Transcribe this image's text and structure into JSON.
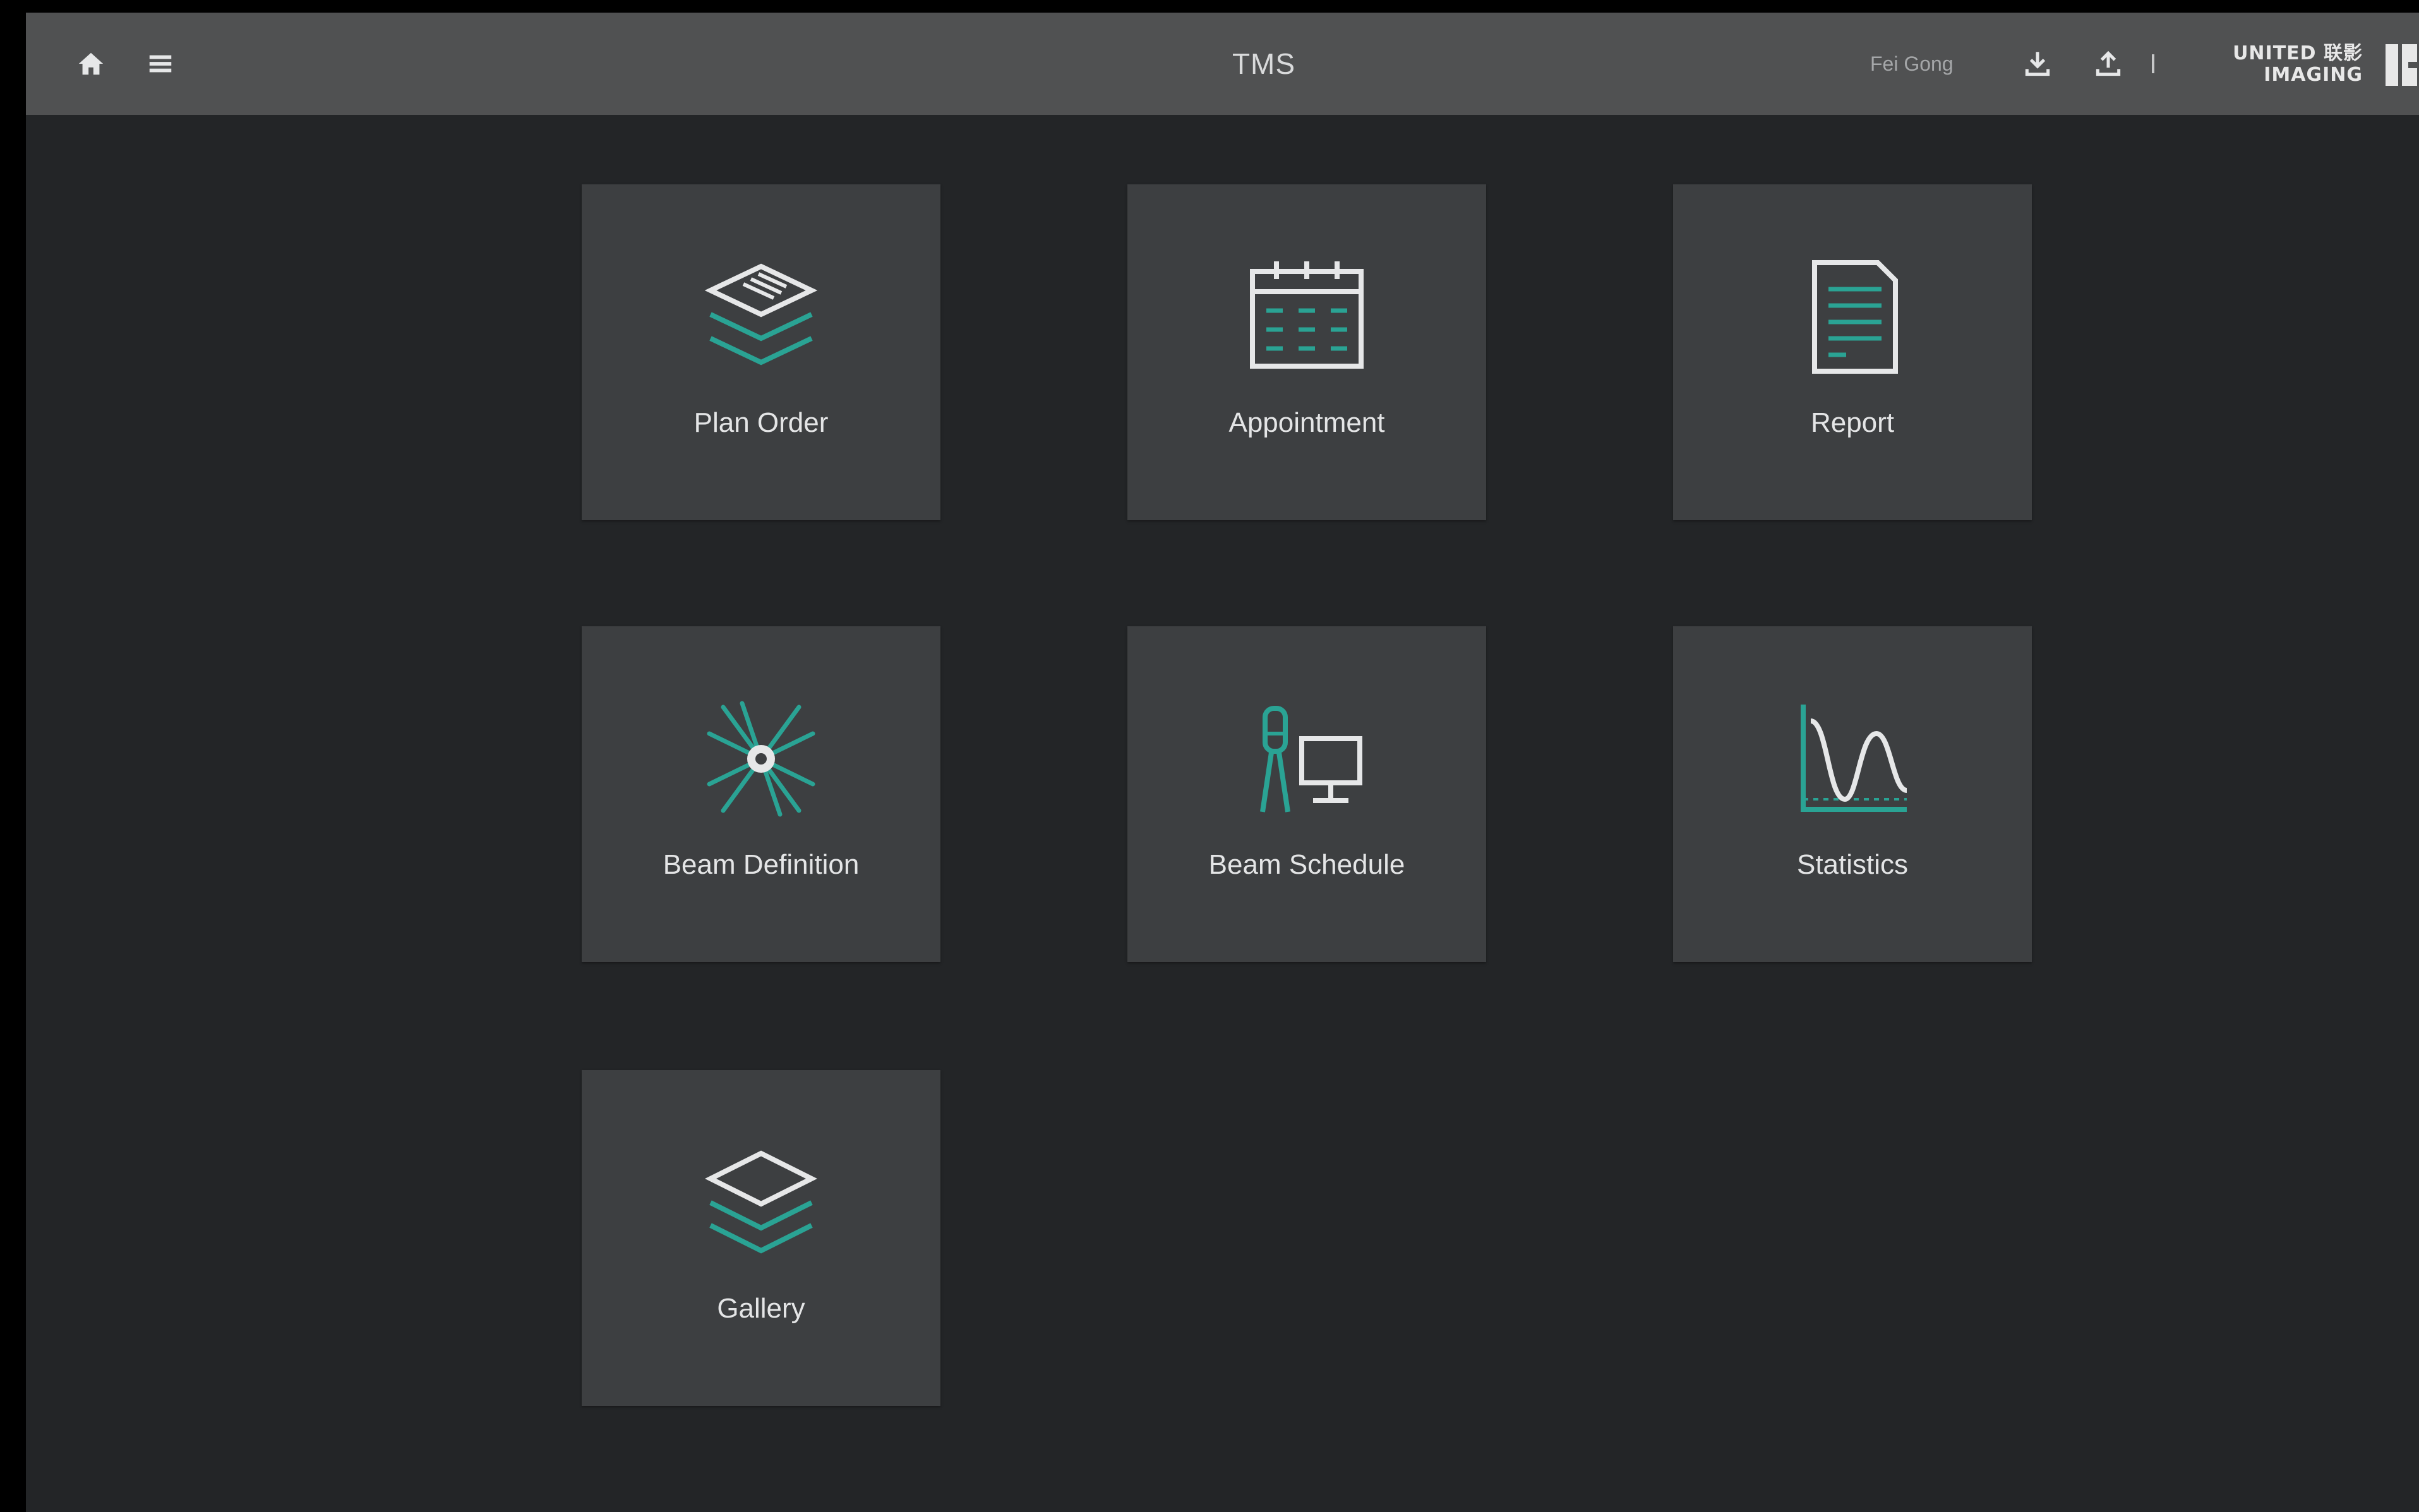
{
  "header": {
    "title": "TMS",
    "user_name": "Fei Gong",
    "brand_name": "UNITED 联影 IMAGING"
  },
  "tiles": [
    {
      "label": "Plan Order",
      "icon": "stacked-layers-document-icon"
    },
    {
      "label": "Appointment",
      "icon": "calendar-icon"
    },
    {
      "label": "Report",
      "icon": "document-icon"
    },
    {
      "label": "Beam Definition",
      "icon": "beam-burst-icon"
    },
    {
      "label": "Beam Schedule",
      "icon": "person-monitor-icon"
    },
    {
      "label": "Statistics",
      "icon": "curve-chart-icon"
    },
    {
      "label": "Gallery",
      "icon": "layers-icon"
    }
  ],
  "colors": {
    "background": "#232527",
    "topbar": "#505152",
    "tile": "#3d3f41",
    "accent": "#2aa394",
    "icon_line": "#e6e7e8"
  }
}
